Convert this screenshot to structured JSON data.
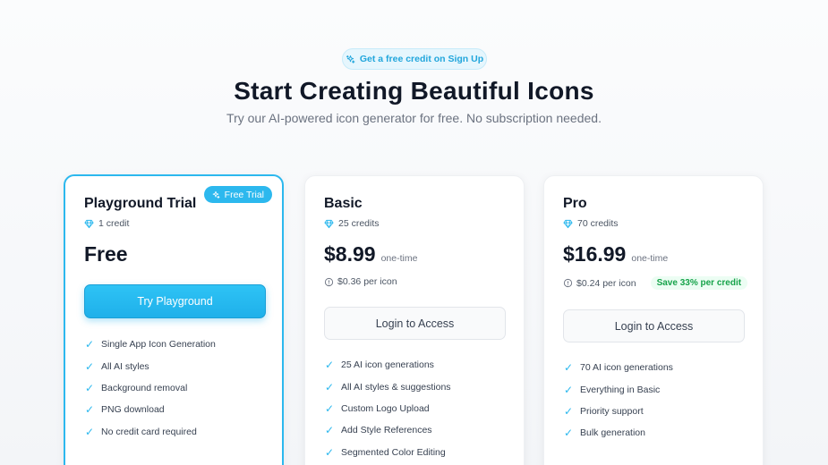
{
  "promo_badge": {
    "icon": "sparkle-icon",
    "label": "Get a free credit on Sign Up"
  },
  "hero": {
    "title": "Start Creating Beautiful Icons",
    "subtitle": "Try our AI-powered icon generator for free. No subscription needed."
  },
  "colors": {
    "accent": "#2cb8ee",
    "save_green": "#16a34a",
    "text": "#111827",
    "muted": "#6b7280"
  },
  "plans": [
    {
      "name": "Playground Trial",
      "badge": "Free Trial",
      "credits": "1 credit",
      "price": "Free",
      "button": "Try Playground",
      "features": [
        "Single App Icon Generation",
        "All AI styles",
        "Background removal",
        "PNG download",
        "No credit card required"
      ]
    },
    {
      "name": "Basic",
      "credits": "25 credits",
      "price": "$8.99",
      "price_note": "one-time",
      "per_icon": "$0.36 per icon",
      "button": "Login to Access",
      "features": [
        "25 AI icon generations",
        "All AI styles & suggestions",
        "Custom Logo Upload",
        "Add Style References",
        "Segmented Color Editing"
      ]
    },
    {
      "name": "Pro",
      "credits": "70 credits",
      "price": "$16.99",
      "price_note": "one-time",
      "per_icon": "$0.24 per icon",
      "save": "Save 33% per credit",
      "button": "Login to Access",
      "features": [
        "70 AI icon generations",
        "Everything in Basic",
        "Priority support",
        "Bulk generation"
      ]
    }
  ]
}
